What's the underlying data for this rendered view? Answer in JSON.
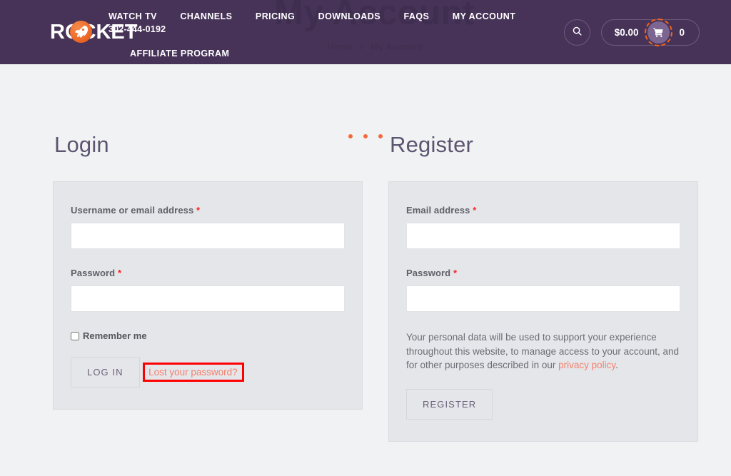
{
  "header": {
    "logo_text": "ROCKET",
    "logo_icon": "rocket-icon",
    "page_title_bg": "My Account",
    "breadcrumb": {
      "home": "Home",
      "separator": "/",
      "current": "My Account"
    },
    "nav_row_1": [
      {
        "label": "WATCH TV"
      },
      {
        "label": "CHANNELS"
      },
      {
        "label": "PRICING"
      },
      {
        "label": "DOWNLOADS"
      },
      {
        "label": "FAQS"
      },
      {
        "label": "MY ACCOUNT"
      }
    ],
    "nav_row_2": [
      {
        "label": "AFFILIATE PROGRAM"
      }
    ],
    "phone": "302-444-0192",
    "search_icon": "search-icon",
    "cart": {
      "amount": "$0.00",
      "count": "0",
      "icon": "shopping-cart-icon",
      "highlighted": true
    },
    "colors": {
      "header_bg": "#473358",
      "accent_orange": "#f4641d",
      "cart_icon_bg": "#7d6591"
    }
  },
  "carousel_dots": {
    "count": 3,
    "color": "#f4693a"
  },
  "login": {
    "heading": "Login",
    "username": {
      "label": "Username or email address",
      "required_marker": "*",
      "value": "",
      "placeholder": ""
    },
    "password": {
      "label": "Password",
      "required_marker": "*",
      "value": "",
      "placeholder": ""
    },
    "remember_label": "Remember me",
    "remember_checked": false,
    "submit_label": "LOG IN",
    "lost_password_label": "Lost your password?",
    "annotation": {
      "color": "#fe0000",
      "target": "lost-your-password-link"
    }
  },
  "register": {
    "heading": "Register",
    "email": {
      "label": "Email address",
      "required_marker": "*",
      "value": "",
      "placeholder": ""
    },
    "password": {
      "label": "Password",
      "required_marker": "*",
      "value": "",
      "placeholder": ""
    },
    "privacy_text_before": "Your personal data will be used to support your experience throughout this website, to manage access to your account, and for other purposes described in our ",
    "privacy_link_label": "privacy policy",
    "privacy_text_after": ".",
    "submit_label": "REGISTER"
  },
  "colors": {
    "page_bg": "#f1f2f4",
    "panel_bg": "#e5e6ea",
    "heading": "#5d5470",
    "link_salmon": "#f4806b",
    "required_red": "#ff1f1f"
  }
}
